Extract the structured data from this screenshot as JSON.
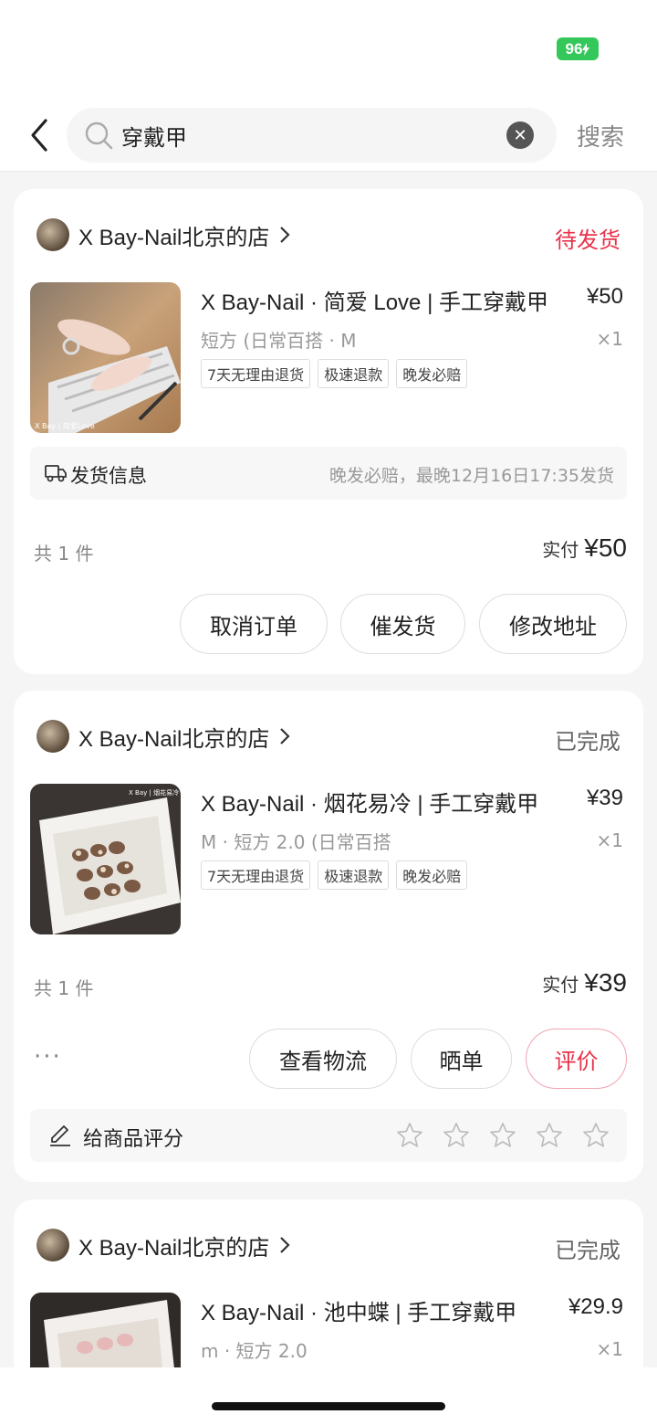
{
  "status_bar": {
    "battery": "96"
  },
  "search": {
    "query": "穿戴甲",
    "clear_label": "✕",
    "submit_label": "搜索"
  },
  "orders": [
    {
      "shop": "X Bay-Nail北京的店",
      "status": "待发货",
      "title": "X Bay-Nail · 简爱 Love | 手工穿戴甲",
      "price": "¥50",
      "sku": "短方 (日常百搭 · M",
      "qty": "×1",
      "tags": [
        "7天无理由退货",
        "极速退款",
        "晚发必赔"
      ],
      "thumb_caption": "X Bay | 简爱Love",
      "shipping": {
        "label": "发货信息",
        "detail": "晚发必赔，最晚12月16日17:35发货"
      },
      "count": "共 1 件",
      "paid_label": "实付",
      "paid": "¥50",
      "buttons": [
        "取消订单",
        "催发货",
        "修改地址"
      ]
    },
    {
      "shop": "X Bay-Nail北京的店",
      "status": "已完成",
      "title": "X Bay-Nail · 烟花易冷 | 手工穿戴甲",
      "price": "¥39",
      "sku": "M · 短方 2.0 (日常百搭",
      "qty": "×1",
      "tags": [
        "7天无理由退货",
        "极速退款",
        "晚发必赔"
      ],
      "thumb_caption": "X Bay | 烟花易冷 //短方",
      "count": "共 1 件",
      "paid_label": "实付",
      "paid": "¥39",
      "more": "···",
      "buttons": [
        "查看物流",
        "晒单",
        "评价"
      ],
      "rate_label": "给商品评分"
    },
    {
      "shop": "X Bay-Nail北京的店",
      "status": "已完成",
      "title": "X Bay-Nail · 池中蝶 | 手工穿戴甲",
      "price": "¥29.9",
      "sku": "m · 短方 2.0",
      "qty": "×1"
    }
  ]
}
